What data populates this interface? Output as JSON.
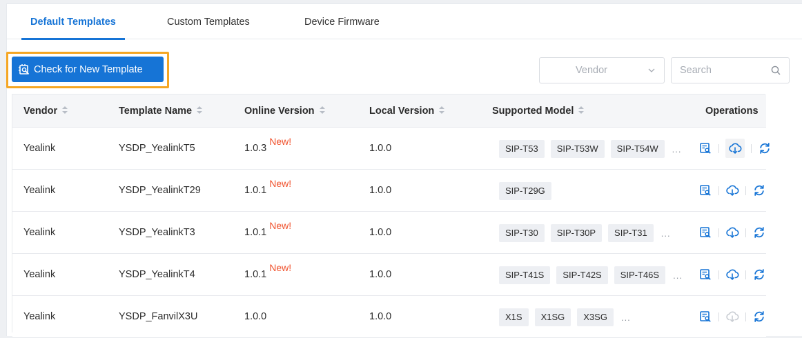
{
  "tabs": [
    {
      "label": "Default Templates",
      "active": true
    },
    {
      "label": "Custom Templates",
      "active": false
    },
    {
      "label": "Device Firmware",
      "active": false
    }
  ],
  "toolbar": {
    "check_button_label": "Check for New Template",
    "vendor_placeholder": "Vendor",
    "search_placeholder": "Search"
  },
  "table": {
    "headers": {
      "vendor": "Vendor",
      "template_name": "Template Name",
      "online_version": "Online Version",
      "local_version": "Local Version",
      "supported_model": "Supported Model",
      "operations": "Operations"
    },
    "new_label": "New!",
    "more_label": "...",
    "rows": [
      {
        "vendor": "Yealink",
        "template": "YSDP_YealinkT5",
        "online": "1.0.3",
        "is_new": true,
        "local": "1.0.0",
        "models": [
          "SIP-T53",
          "SIP-T53W",
          "SIP-T54W"
        ],
        "more": true
      },
      {
        "vendor": "Yealink",
        "template": "YSDP_YealinkT29",
        "online": "1.0.1",
        "is_new": true,
        "local": "1.0.0",
        "models": [
          "SIP-T29G"
        ],
        "more": false
      },
      {
        "vendor": "Yealink",
        "template": "YSDP_YealinkT3",
        "online": "1.0.1",
        "is_new": true,
        "local": "1.0.0",
        "models": [
          "SIP-T30",
          "SIP-T30P",
          "SIP-T31"
        ],
        "more": true
      },
      {
        "vendor": "Yealink",
        "template": "YSDP_YealinkT4",
        "online": "1.0.1",
        "is_new": true,
        "local": "1.0.0",
        "models": [
          "SIP-T41S",
          "SIP-T42S",
          "SIP-T46S"
        ],
        "more": true
      },
      {
        "vendor": "Yealink",
        "template": "YSDP_FanvilX3U",
        "online": "1.0.0",
        "is_new": false,
        "local": "1.0.0",
        "models": [
          "X1S",
          "X1SG",
          "X3SG"
        ],
        "more": true
      }
    ]
  },
  "colors": {
    "accent": "#1674d6",
    "new_tag": "#f0512c",
    "highlight_border": "#f5a623",
    "disabled_icon": "#c9cdd3"
  },
  "icons": {
    "check_button": "template-check-icon",
    "view": "view-template-icon",
    "download": "cloud-download-icon",
    "update": "refresh-icon",
    "select": "chevron-down-icon",
    "search": "search-icon"
  }
}
